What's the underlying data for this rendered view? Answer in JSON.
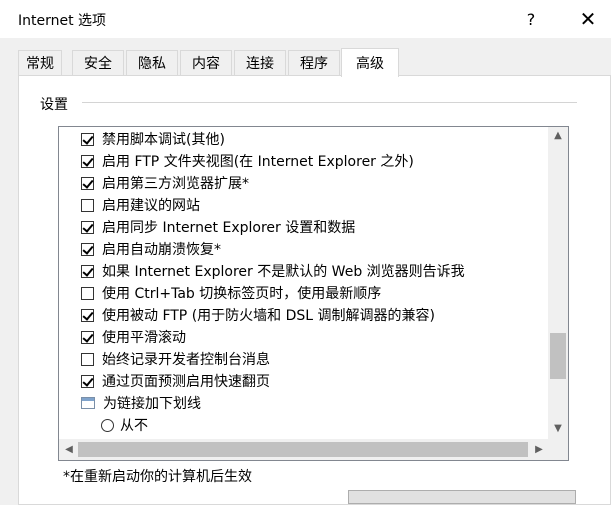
{
  "window": {
    "title": "Internet 选项",
    "help_label": "?",
    "close_label": "✕"
  },
  "tabs": [
    {
      "label": "常规"
    },
    {
      "label": "安全"
    },
    {
      "label": "隐私"
    },
    {
      "label": "内容"
    },
    {
      "label": "连接"
    },
    {
      "label": "程序"
    },
    {
      "label": "高级",
      "active": true
    }
  ],
  "settings": {
    "group_label": "设置",
    "items": [
      {
        "type": "checkbox",
        "checked": true,
        "label": "禁用脚本调试(其他)"
      },
      {
        "type": "checkbox",
        "checked": true,
        "label": "启用 FTP 文件夹视图(在 Internet Explorer 之外)"
      },
      {
        "type": "checkbox",
        "checked": true,
        "label": "启用第三方浏览器扩展*"
      },
      {
        "type": "checkbox",
        "checked": false,
        "label": "启用建议的网站"
      },
      {
        "type": "checkbox",
        "checked": true,
        "label": "启用同步 Internet Explorer 设置和数据"
      },
      {
        "type": "checkbox",
        "checked": true,
        "label": "启用自动崩溃恢复*"
      },
      {
        "type": "checkbox",
        "checked": true,
        "label": "如果 Internet Explorer 不是默认的 Web 浏览器则告诉我"
      },
      {
        "type": "checkbox",
        "checked": false,
        "label": "使用 Ctrl+Tab 切换标签页时，使用最新顺序"
      },
      {
        "type": "checkbox",
        "checked": true,
        "label": "使用被动 FTP (用于防火墙和 DSL 调制解调器的兼容)"
      },
      {
        "type": "checkbox",
        "checked": true,
        "label": "使用平滑滚动"
      },
      {
        "type": "checkbox",
        "checked": false,
        "label": "始终记录开发者控制台消息"
      },
      {
        "type": "checkbox",
        "checked": true,
        "label": "通过页面预测启用快速翻页"
      },
      {
        "type": "group",
        "label": "为链接加下划线"
      },
      {
        "type": "radio",
        "checked": false,
        "label": "从不"
      }
    ],
    "scroll_up": "▲",
    "scroll_down": "▼",
    "scroll_left": "◀",
    "scroll_right": "▶"
  },
  "footer_note": "*在重新启动你的计算机后生效"
}
